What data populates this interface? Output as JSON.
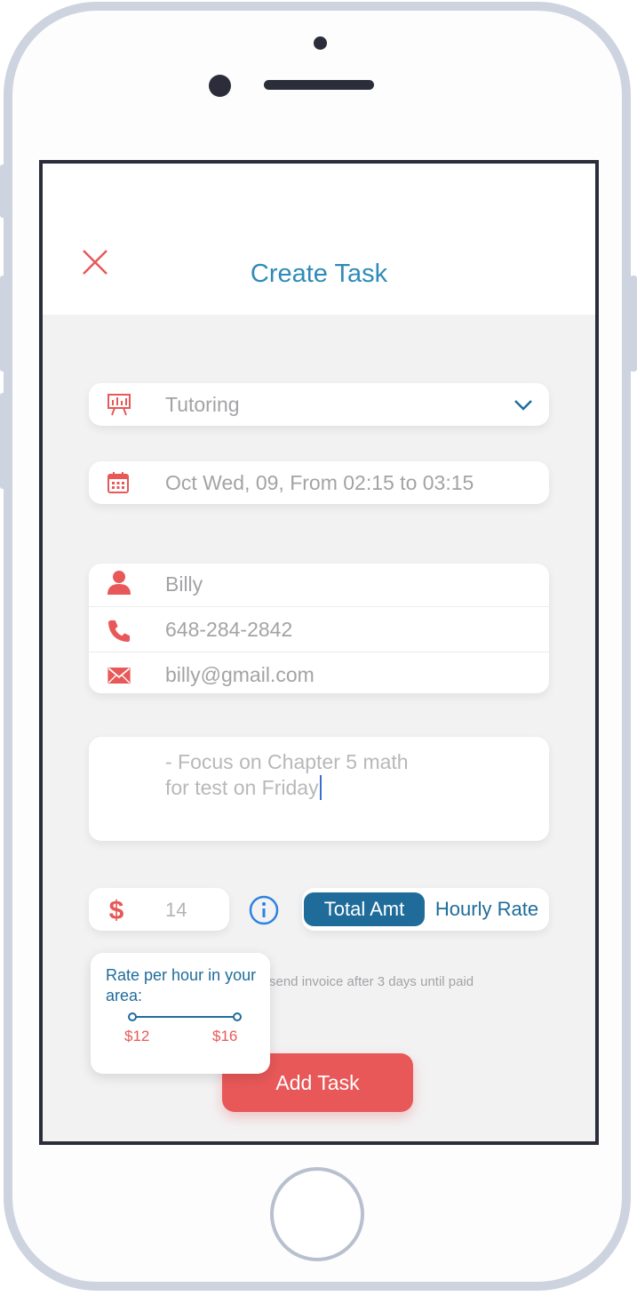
{
  "header": {
    "title": "Create Task"
  },
  "form": {
    "category": "Tutoring",
    "schedule": "Oct Wed, 09, From 02:15 to 03:15",
    "contact": {
      "name": "Billy",
      "phone": "648-284-2842",
      "email": "billy@gmail.com"
    },
    "notes": "- Focus on Chapter 5 math\nfor test on Friday",
    "amount": "14",
    "toggle": {
      "active_label": "Total Amt",
      "inactive_label": "Hourly Rate"
    },
    "invoice_note": "send invoice after 3 days until paid"
  },
  "tooltip": {
    "title": "Rate per hour in your area:",
    "low": "$12",
    "high": "$16"
  },
  "submit_label": "Add Task",
  "colors": {
    "accent_red": "#e85858",
    "accent_blue": "#1f6c9b",
    "title_blue": "#2e8bb8"
  },
  "icons": {
    "close": "close-icon",
    "category": "presentation-board-icon",
    "calendar": "calendar-icon",
    "person": "person-icon",
    "phone": "phone-icon",
    "mail": "mail-icon",
    "dollar": "dollar-icon",
    "info": "info-icon",
    "dropdown": "chevron-down-icon"
  }
}
